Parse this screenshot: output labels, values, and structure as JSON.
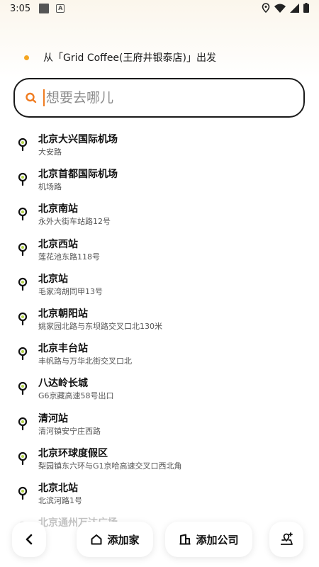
{
  "status_bar": {
    "time": "3:05",
    "notification_icons": [
      "square-icon",
      "a-badge-icon"
    ],
    "system_icons": [
      "location-icon",
      "wifi-icon",
      "signal-icon",
      "battery-icon"
    ]
  },
  "origin": {
    "text": "从「Grid Coffee(王府井银泰店)」出发",
    "dot_color": "#f5a623"
  },
  "search": {
    "placeholder": "想要去哪儿",
    "value": "",
    "accent_color": "#f07c21"
  },
  "suggestions": [
    {
      "name": "北京大兴国际机场",
      "address": "大安路"
    },
    {
      "name": "北京首都国际机场",
      "address": "机场路"
    },
    {
      "name": "北京南站",
      "address": "永外大街车站路12号"
    },
    {
      "name": "北京西站",
      "address": "莲花池东路118号"
    },
    {
      "name": "北京站",
      "address": "毛家湾胡同甲13号"
    },
    {
      "name": "北京朝阳站",
      "address": "姚家园北路与东坝路交叉口北130米"
    },
    {
      "name": "北京丰台站",
      "address": "丰帆路与万华北街交叉口北"
    },
    {
      "name": "八达岭长城",
      "address": "G6京藏高速58号出口"
    },
    {
      "name": "清河站",
      "address": "清河镇安宁庄西路"
    },
    {
      "name": "北京环球度假区",
      "address": "梨园镇东六环与G1京哈高速交叉口西北角"
    },
    {
      "name": "北京北站",
      "address": "北滨河路1号"
    },
    {
      "name": "北京通州万达广场",
      "address": ""
    }
  ],
  "bottom_bar": {
    "back_icon": "chevron-left-icon",
    "home_label": "添加家",
    "home_icon": "house-icon",
    "work_label": "添加公司",
    "work_icon": "building-icon",
    "add_icon": "add-place-icon"
  }
}
